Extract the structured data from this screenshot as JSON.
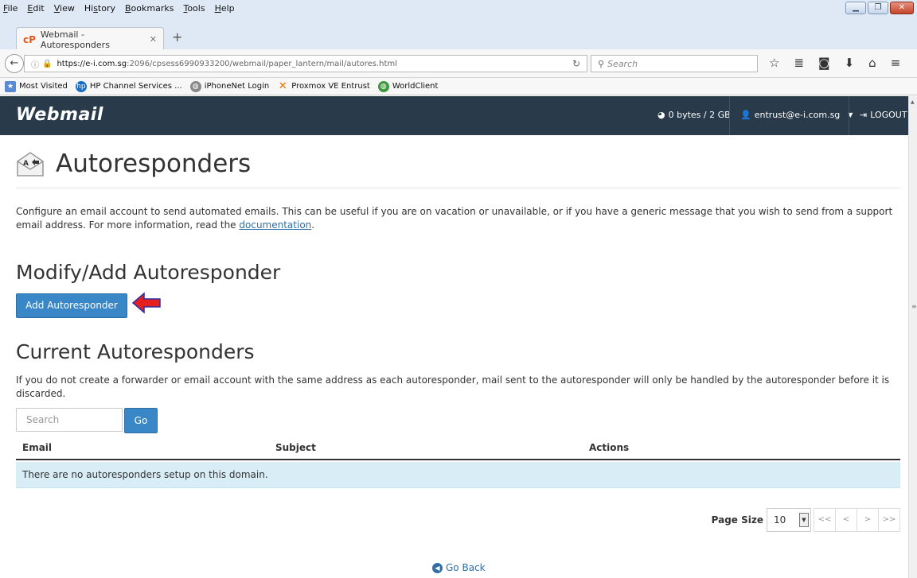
{
  "browser": {
    "menu": [
      "File",
      "Edit",
      "View",
      "History",
      "Bookmarks",
      "Tools",
      "Help"
    ],
    "menu_underline": [
      "F",
      "E",
      "V",
      "s",
      "B",
      "T",
      "H"
    ],
    "tab_title": "Webmail - Autoresponders",
    "url_domain": "https://e-i.com.sg",
    "url_path": ":2096/cpsess6990933200/webmail/paper_lantern/mail/autores.html",
    "search_placeholder": "Search",
    "bookmarks": [
      "Most Visited",
      "HP Channel Services ...",
      "iPhoneNet Login",
      "Proxmox VE Entrust",
      "WorldClient"
    ]
  },
  "header": {
    "logo": "Webmail",
    "quota": "0 bytes / 2 GB",
    "user": "entrust@e-i.com.sg",
    "logout": "LOGOUT"
  },
  "page": {
    "title": "Autoresponders",
    "description": "Configure an email account to send automated emails. This can be useful if you are on vacation or unavailable, or if you have a generic message that you wish to send from a support email address. For more information, read the ",
    "doc_link": "documentation",
    "desc_end": "."
  },
  "modify": {
    "heading": "Modify/Add Autoresponder",
    "add_button": "Add Autoresponder"
  },
  "current": {
    "heading": "Current Autoresponders",
    "note": "If you do not create a forwarder or email account with the same address as each autoresponder, mail sent to the autoresponder will only be handled by the autoresponder before it is discarded.",
    "search_placeholder": "Search",
    "go_button": "Go",
    "columns": [
      "Email",
      "Subject",
      "Actions"
    ],
    "empty_message": "There are no autoresponders setup on this domain."
  },
  "pagination": {
    "label": "Page Size",
    "value": "10",
    "first": "<<",
    "prev": "<",
    "next": ">",
    "last": ">>"
  },
  "footer": {
    "go_back": "Go Back"
  }
}
